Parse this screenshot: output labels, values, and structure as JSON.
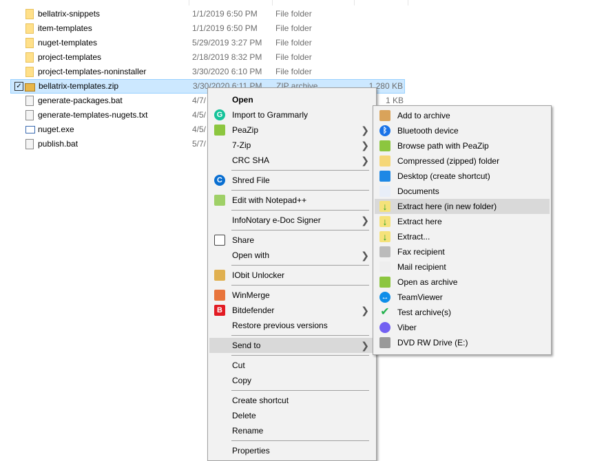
{
  "files": [
    {
      "name": "bellatrix-snippets",
      "date": "1/1/2019 6:50 PM",
      "type": "File folder",
      "size": "",
      "icon": "folder-icon"
    },
    {
      "name": "item-templates",
      "date": "1/1/2019 6:50 PM",
      "type": "File folder",
      "size": "",
      "icon": "folder-icon"
    },
    {
      "name": "nuget-templates",
      "date": "5/29/2019 3:27 PM",
      "type": "File folder",
      "size": "",
      "icon": "folder-icon"
    },
    {
      "name": "project-templates",
      "date": "2/18/2019 8:32 PM",
      "type": "File folder",
      "size": "",
      "icon": "folder-icon"
    },
    {
      "name": "project-templates-noninstaller",
      "date": "3/30/2020 6:10 PM",
      "type": "File folder",
      "size": "",
      "icon": "folder-icon"
    },
    {
      "name": "bellatrix-templates.zip",
      "date": "3/30/2020 6:11 PM",
      "type": "ZIP archive",
      "size": "1,280 KB",
      "icon": "zip-archive-icon",
      "selected": true
    },
    {
      "name": "generate-packages.bat",
      "date": "4/7/",
      "type": "",
      "size": "1 KB",
      "icon": "batch-file-icon"
    },
    {
      "name": "generate-templates-nugets.txt",
      "date": "4/5/",
      "type": "",
      "size": "",
      "icon": "text-file-icon"
    },
    {
      "name": "nuget.exe",
      "date": "4/5/",
      "type": "",
      "size": "",
      "icon": "exe-file-icon"
    },
    {
      "name": "publish.bat",
      "date": "5/7/",
      "type": "",
      "size": "",
      "icon": "batch-file-icon"
    }
  ],
  "context_menu": [
    {
      "label": "Open",
      "bold": true
    },
    {
      "label": "Import to Grammarly",
      "icon": "grammarly-icon"
    },
    {
      "label": "PeaZip",
      "icon": "peazip-icon",
      "submenu": true
    },
    {
      "label": "7-Zip",
      "submenu": true
    },
    {
      "label": "CRC SHA",
      "submenu": true
    },
    {
      "sep": true
    },
    {
      "label": "Shred File",
      "icon": "shred-icon"
    },
    {
      "sep": true
    },
    {
      "label": "Edit with Notepad++",
      "icon": "notepad-plus-plus-icon"
    },
    {
      "sep": true
    },
    {
      "label": "InfoNotary e-Doc Signer",
      "submenu": true
    },
    {
      "sep": true
    },
    {
      "label": "Share",
      "icon": "share-icon"
    },
    {
      "label": "Open with",
      "submenu": true
    },
    {
      "sep": true
    },
    {
      "label": "IObit Unlocker",
      "icon": "unlock-icon"
    },
    {
      "sep": true
    },
    {
      "label": "WinMerge",
      "icon": "winmerge-icon"
    },
    {
      "label": "Bitdefender",
      "icon": "bitdefender-icon",
      "submenu": true
    },
    {
      "label": "Restore previous versions"
    },
    {
      "sep": true
    },
    {
      "label": "Send to",
      "submenu": true,
      "highlighted": true
    },
    {
      "sep": true
    },
    {
      "label": "Cut"
    },
    {
      "label": "Copy"
    },
    {
      "sep": true
    },
    {
      "label": "Create shortcut"
    },
    {
      "label": "Delete"
    },
    {
      "label": "Rename"
    },
    {
      "sep": true
    },
    {
      "label": "Properties"
    }
  ],
  "send_to_menu": [
    {
      "label": "Add to archive",
      "icon": "add-archive-icon"
    },
    {
      "label": "Bluetooth device",
      "icon": "bluetooth-icon"
    },
    {
      "label": "Browse path with PeaZip",
      "icon": "peazip-icon"
    },
    {
      "label": "Compressed (zipped) folder",
      "icon": "zip-folder-icon"
    },
    {
      "label": "Desktop (create shortcut)",
      "icon": "desktop-icon"
    },
    {
      "label": "Documents",
      "icon": "documents-icon"
    },
    {
      "label": "Extract here (in new folder)",
      "icon": "extract-icon",
      "highlighted": true
    },
    {
      "label": "Extract here",
      "icon": "extract-icon"
    },
    {
      "label": "Extract...",
      "icon": "extract-icon"
    },
    {
      "label": "Fax recipient",
      "icon": "fax-icon"
    },
    {
      "label": "Mail recipient",
      "icon": "mail-icon"
    },
    {
      "label": "Open as archive",
      "icon": "peazip-icon"
    },
    {
      "label": "TeamViewer",
      "icon": "teamviewer-icon"
    },
    {
      "label": "Test archive(s)",
      "icon": "checkmark-icon"
    },
    {
      "label": "Viber",
      "icon": "viber-icon"
    },
    {
      "label": "DVD RW Drive (E:)",
      "icon": "dvd-drive-icon"
    }
  ],
  "colors": {
    "selection": "#cce8ff",
    "menu_bg": "#f2f2f2",
    "menu_highlight": "#d9d9d9"
  }
}
